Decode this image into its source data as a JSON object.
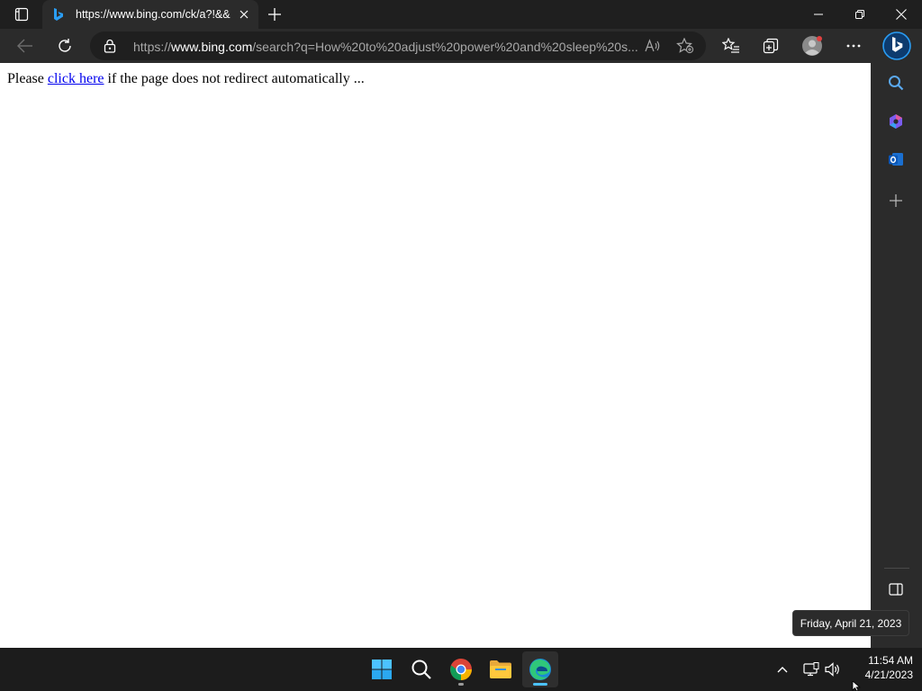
{
  "browser": {
    "tab": {
      "title": "https://www.bing.com/ck/a?!&&p",
      "favicon": "bing-icon"
    },
    "address_bar": {
      "url_prefix": "https://",
      "url_host": "www.bing.com",
      "url_path": "/search?q=How%20to%20adjust%20power%20and%20sleep%20s..."
    }
  },
  "page": {
    "text_before": "Please ",
    "link_text": "click here",
    "text_after": " if the page does not redirect automatically ..."
  },
  "sidebar": {
    "items": [
      "search-icon",
      "copilot-icon",
      "outlook-icon",
      "add-icon"
    ]
  },
  "taskbar": {
    "apps": [
      "windows-start",
      "search",
      "chrome",
      "file-explorer",
      "edge"
    ],
    "clock_time": "11:54 AM",
    "clock_date": "4/21/2023",
    "tooltip": "Friday, April 21, 2023"
  },
  "colors": {
    "titlebar": "#1f1f1f",
    "toolbar": "#2b2b2b",
    "accent_blue": "#0078d4",
    "link": "#0000ee"
  }
}
